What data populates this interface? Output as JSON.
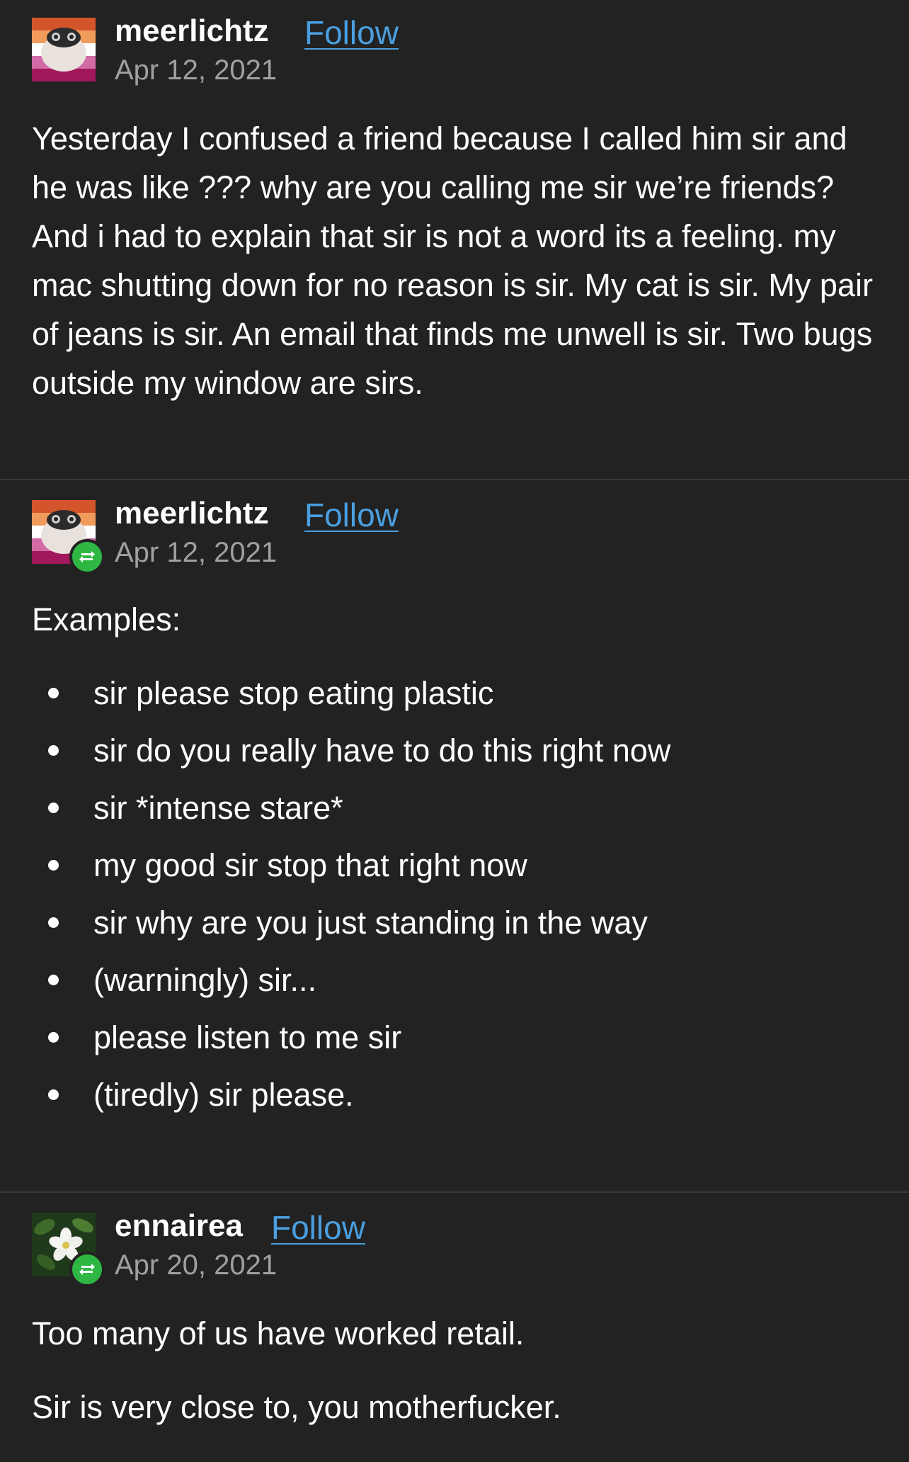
{
  "posts": [
    {
      "username": "meerlichtz",
      "follow_label": "Follow",
      "date": "Apr 12, 2021",
      "reblog": false,
      "text": "Yesterday I confused a friend because I called him sir and he was like ??? why are you calling me sir we’re friends? And i had to explain that sir is not a word its a feeling. my mac shutting down for no reason is sir. My cat is sir. My pair of jeans is sir. An email that finds me unwell is sir. Two bugs outside my window are sirs."
    },
    {
      "username": "meerlichtz",
      "follow_label": "Follow",
      "date": "Apr 12, 2021",
      "reblog": true,
      "intro": "Examples:",
      "items": [
        "sir please stop eating plastic",
        "sir do you really have to do this right now",
        "sir *intense stare*",
        "my good sir stop that right now",
        "sir why are you just standing in the way",
        "(warningly) sir...",
        "please listen to me sir",
        "(tiredly) sir please."
      ]
    },
    {
      "username": "ennairea",
      "follow_label": "Follow",
      "date": "Apr 20, 2021",
      "reblog": true,
      "paragraphs": [
        "Too many of us have worked retail.",
        "Sir is very close to, you motherfucker."
      ]
    }
  ],
  "colors": {
    "background": "#222222",
    "text": "#ffffff",
    "date": "#a0a0a0",
    "follow_link": "#4a9fe0",
    "reblog_badge": "#2fb744",
    "divider": "#3a3a3a"
  },
  "icons": {
    "reblog": "reblog-icon",
    "avatar_1": "cat-avatar-icon",
    "avatar_3": "flower-avatar-icon"
  }
}
